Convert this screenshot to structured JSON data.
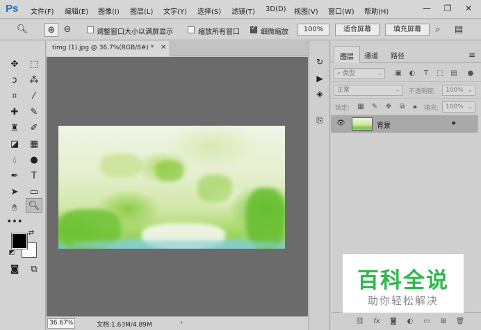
{
  "app": {
    "logo": "Ps"
  },
  "menu": [
    "文件(F)",
    "编辑(E)",
    "图像(I)",
    "图层(L)",
    "文字(Y)",
    "选择(S)",
    "滤镜(T)",
    "3D(D)",
    "视图(V)",
    "窗口(W)",
    "帮助(H)"
  ],
  "window_controls": {
    "minimize": "—",
    "restore": "❐",
    "close": "✕"
  },
  "options": {
    "resize_windows_label": "调整窗口大小以满屏显示",
    "resize_windows_checked": false,
    "zoom_all_label": "缩放所有窗口",
    "zoom_all_checked": false,
    "scrubby_zoom_label": "细微缩放",
    "scrubby_zoom_checked": true,
    "percent_button": "100%",
    "fit_screen_button": "适合屏幕",
    "fill_screen_button": "填充屏幕"
  },
  "document": {
    "tab_title": "timg (1).jpg @ 36.7%(RGB/8#) *",
    "zoom": "36.67%",
    "doc_info": "文档:1.63M/4.89M"
  },
  "colors": {
    "foreground": "#000000",
    "background": "#ffffff",
    "canvas_bg": "#6b6b6b",
    "ui_bg": "#d3d3d3",
    "watermark_green": "#2db84d"
  },
  "layers_panel": {
    "tabs": [
      "图层",
      "通道",
      "路径"
    ],
    "active_tab": "图层",
    "filter_kind": "类型",
    "blend_mode": "正常",
    "opacity_label": "不透明度:",
    "opacity_value": "100%",
    "lock_label": "锁定:",
    "fill_label": "填充:",
    "fill_value": "100%",
    "layers": [
      {
        "name": "背景",
        "visible": true,
        "locked": true
      }
    ]
  },
  "watermark": {
    "title": "百科全说",
    "subtitle": "助你轻松解决"
  }
}
